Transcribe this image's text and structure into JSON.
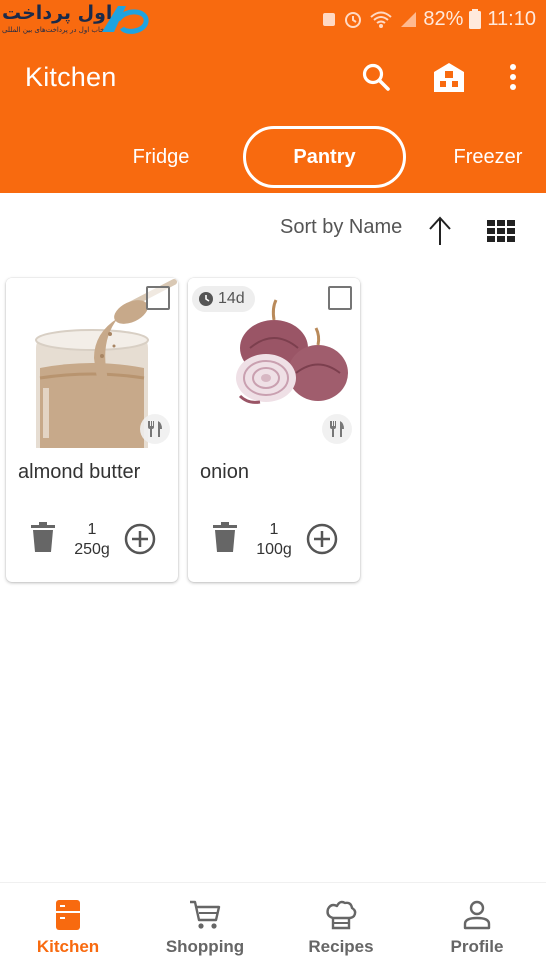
{
  "status_bar": {
    "logo_text": "اول پرداخت",
    "logo_subtext": "انتخاب اول در پرداخت‌های بین المللی",
    "battery": "82%",
    "time": "11:10"
  },
  "app_bar": {
    "title": "Kitchen",
    "icons": [
      "search-icon",
      "house-icon",
      "more-vert-icon"
    ]
  },
  "tabs": [
    {
      "label": "Fridge",
      "active": false
    },
    {
      "label": "Pantry",
      "active": true
    },
    {
      "label": "Freezer",
      "active": false
    }
  ],
  "sort": {
    "label": "Sort by Name",
    "direction": "ascending",
    "view": "grid"
  },
  "items": [
    {
      "name": "almond butter",
      "count": "1",
      "amount": "250g",
      "expiry": null,
      "selected": false
    },
    {
      "name": "onion",
      "count": "1",
      "amount": "100g",
      "expiry": "14d",
      "selected": false
    }
  ],
  "bottom_nav": [
    {
      "label": "Kitchen",
      "icon": "fridge-icon",
      "active": true
    },
    {
      "label": "Shopping",
      "icon": "cart-icon",
      "active": false
    },
    {
      "label": "Recipes",
      "icon": "chef-hat-icon",
      "active": false
    },
    {
      "label": "Profile",
      "icon": "person-icon",
      "active": false
    }
  ],
  "colors": {
    "accent": "#f86a0f",
    "card_bg": "#ffffff",
    "icon_gray": "#666666"
  }
}
